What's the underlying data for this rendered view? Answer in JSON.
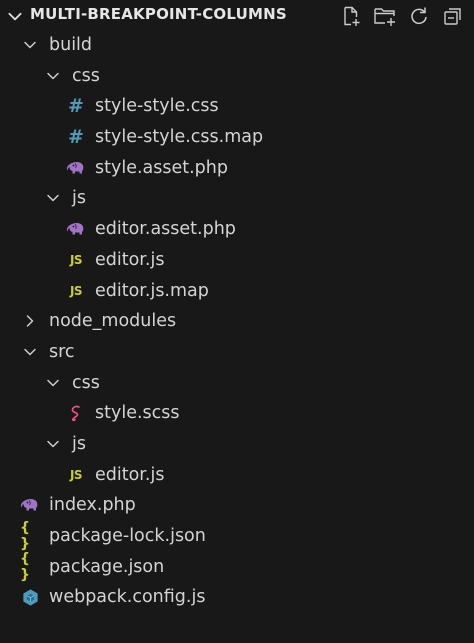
{
  "explorer": {
    "title": "MULTI-BREAKPOINT-COLUMNS",
    "actions": [
      {
        "name": "new-file",
        "icon": "new-file-icon"
      },
      {
        "name": "new-folder",
        "icon": "new-folder-icon"
      },
      {
        "name": "refresh",
        "icon": "refresh-icon"
      },
      {
        "name": "collapse-all",
        "icon": "collapse-all-icon"
      }
    ]
  },
  "tree": [
    {
      "label": "build",
      "depth": 0,
      "type": "folder",
      "expanded": true
    },
    {
      "label": "css",
      "depth": 1,
      "type": "folder",
      "expanded": true
    },
    {
      "label": "style-style.css",
      "depth": 2,
      "type": "css",
      "icon": "hash-icon"
    },
    {
      "label": "style-style.css.map",
      "depth": 2,
      "type": "css",
      "icon": "hash-icon"
    },
    {
      "label": "style.asset.php",
      "depth": 2,
      "type": "php",
      "icon": "php-elephant-icon"
    },
    {
      "label": "js",
      "depth": 1,
      "type": "folder",
      "expanded": true
    },
    {
      "label": "editor.asset.php",
      "depth": 2,
      "type": "php",
      "icon": "php-elephant-icon"
    },
    {
      "label": "editor.js",
      "depth": 2,
      "type": "js",
      "icon": "js-icon"
    },
    {
      "label": "editor.js.map",
      "depth": 2,
      "type": "js",
      "icon": "js-icon"
    },
    {
      "label": "node_modules",
      "depth": 0,
      "type": "folder",
      "expanded": false
    },
    {
      "label": "src",
      "depth": 0,
      "type": "folder",
      "expanded": true
    },
    {
      "label": "css",
      "depth": 1,
      "type": "folder",
      "expanded": true
    },
    {
      "label": "style.scss",
      "depth": 2,
      "type": "scss",
      "icon": "sass-icon"
    },
    {
      "label": "js",
      "depth": 1,
      "type": "folder",
      "expanded": true
    },
    {
      "label": "editor.js",
      "depth": 2,
      "type": "js",
      "icon": "js-icon"
    },
    {
      "label": "index.php",
      "depth": 0,
      "type": "php",
      "icon": "php-elephant-icon"
    },
    {
      "label": "package-lock.json",
      "depth": 0,
      "type": "json",
      "icon": "json-braces-icon"
    },
    {
      "label": "package.json",
      "depth": 0,
      "type": "json",
      "icon": "json-braces-icon"
    },
    {
      "label": "webpack.config.js",
      "depth": 0,
      "type": "webpack",
      "icon": "webpack-cube-icon"
    }
  ],
  "icon_glyphs": {
    "hash": "#",
    "js": "JS",
    "json": "{ }"
  },
  "colors": {
    "background": "#181818",
    "text": "#d4d4d4",
    "css_icon": "#519aba",
    "js_icon": "#cbcb41",
    "php_icon": "#a074c4",
    "scss_icon": "#f55385",
    "webpack_icon": "#519aba",
    "indent_guide": "#585858"
  }
}
